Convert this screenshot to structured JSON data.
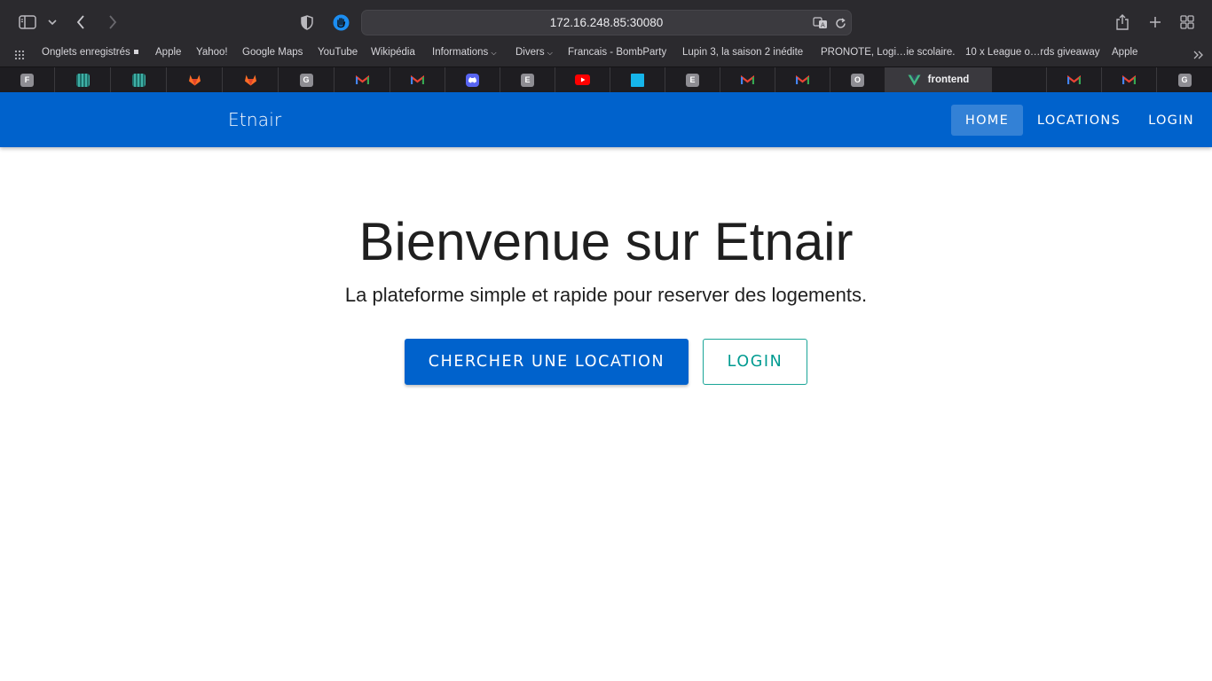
{
  "browser": {
    "url": "172.16.248.85:30080",
    "bookmarks": [
      "Onglets enregistrés",
      "Apple",
      "Yahoo!",
      "Google Maps",
      "YouTube",
      "Wikipédia",
      "Informations",
      "Divers",
      "Francais - BombParty",
      "Lupin 3, la saison 2 inédite",
      "PRONOTE, Logi…ie scolaire.",
      "10 x League o…rds giveaway",
      "Apple"
    ],
    "tabs": [
      {
        "icon": "letter-f-icon",
        "letter": "F"
      },
      {
        "icon": "teal-grid-icon"
      },
      {
        "icon": "teal-grid-icon"
      },
      {
        "icon": "gitlab-icon"
      },
      {
        "icon": "gitlab-icon"
      },
      {
        "icon": "letter-g-icon",
        "letter": "G"
      },
      {
        "icon": "gmail-icon"
      },
      {
        "icon": "gmail-icon"
      },
      {
        "icon": "discord-icon"
      },
      {
        "icon": "letter-e-icon",
        "letter": "E"
      },
      {
        "icon": "youtube-icon"
      },
      {
        "icon": "blue-square-icon"
      },
      {
        "icon": "letter-e-icon",
        "letter": "E"
      },
      {
        "icon": "gmail-icon"
      },
      {
        "icon": "gmail-icon"
      },
      {
        "icon": "letter-o-icon",
        "letter": "O"
      },
      {
        "icon": "vue-icon",
        "label": "frontend",
        "active": true
      },
      {
        "icon": "blank-icon"
      },
      {
        "icon": "gmail-icon"
      },
      {
        "icon": "gmail-icon"
      },
      {
        "icon": "letter-g-icon",
        "letter": "G"
      }
    ]
  },
  "app": {
    "brand": "Etnair",
    "nav": {
      "home": "HOME",
      "locations": "LOCATIONS",
      "login": "LOGIN"
    },
    "hero": {
      "title": "Bienvenue sur Etnair",
      "subtitle": "La plateforme simple et rapide pour reserver des logements.",
      "primary_button": "CHERCHER UNE LOCATION",
      "secondary_button": "LOGIN"
    }
  },
  "colors": {
    "brand_blue": "#0062cc",
    "accent_teal": "#009b91"
  }
}
